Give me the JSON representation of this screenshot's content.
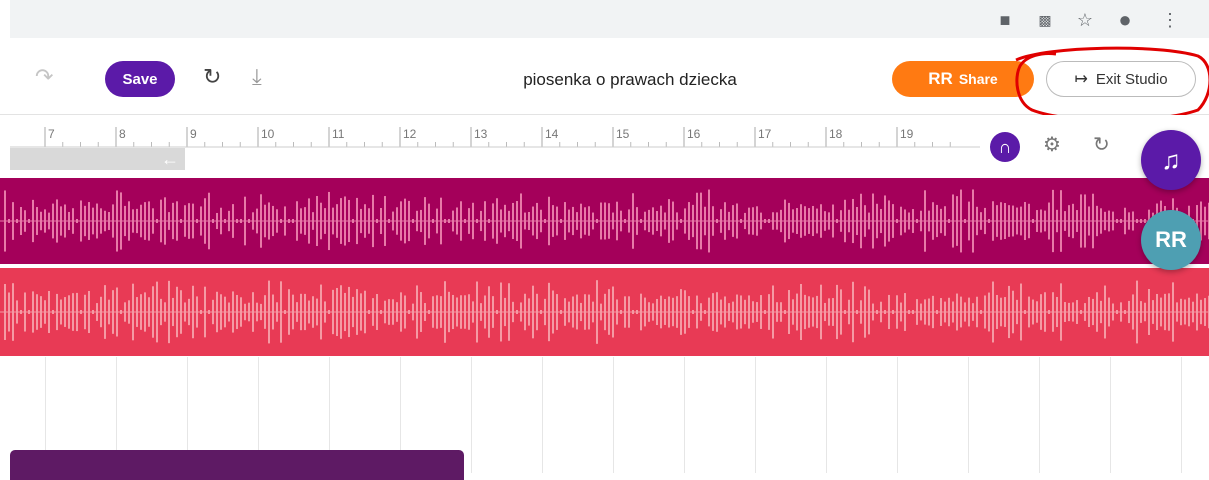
{
  "browser": {
    "icons": [
      "camera-icon",
      "translate-icon",
      "star-icon",
      "profile-icon",
      "more-vert-icon"
    ]
  },
  "toolbar": {
    "save_label": "Save",
    "title": "piosenka o prawach dziecka",
    "share_label": "Share",
    "exit_label": "Exit Studio"
  },
  "ruler": {
    "ticks": [
      "7",
      "8",
      "9",
      "10",
      "11",
      "12",
      "13",
      "14",
      "15",
      "16",
      "17",
      "18",
      "19"
    ]
  },
  "tracks": [
    {
      "color": "#a4005a",
      "wave_color": "#e77aa8"
    },
    {
      "color": "#e83a55",
      "wave_color": "#f59aa4"
    }
  ],
  "colors": {
    "accent": "#5b1aa8",
    "share": "#ff7a12",
    "fab_music": "#5b1aa8",
    "fab_collab": "#4e9fb2",
    "annotation": "#e00000"
  }
}
